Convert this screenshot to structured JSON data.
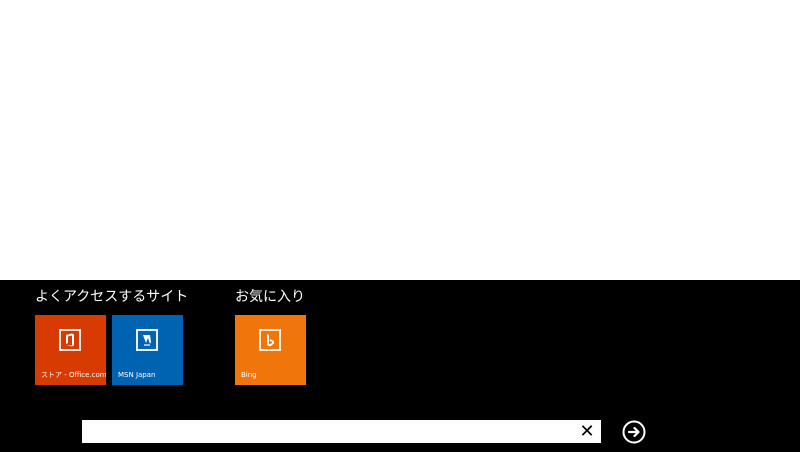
{
  "app_bar": {
    "frequent": {
      "heading": "よくアクセスするサイト",
      "tiles": [
        {
          "label": "ストア - Office.com",
          "color": "#d83b01",
          "icon": "office-icon"
        },
        {
          "label": "MSN Japan",
          "color": "#0063b1",
          "icon": "msn-icon"
        }
      ]
    },
    "favorites": {
      "heading": "お気に入り",
      "tiles": [
        {
          "label": "Bing",
          "color": "#f0750a",
          "icon": "bing-icon"
        }
      ]
    },
    "address": {
      "value": "",
      "clear_glyph": "✕",
      "go_icon": "arrow-right-circle-icon"
    }
  },
  "colors": {
    "app_bar_background": "#000000",
    "page_background": "#ffffff"
  }
}
